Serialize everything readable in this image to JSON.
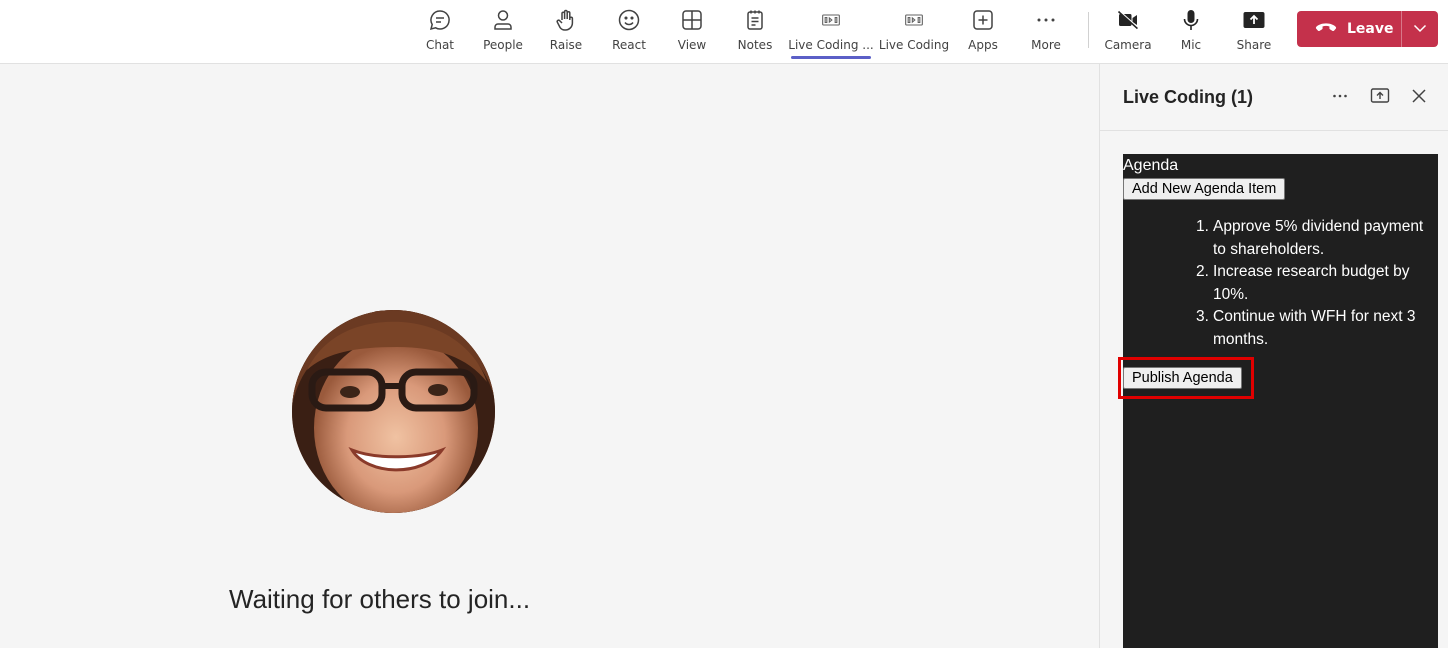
{
  "toolbar": {
    "items": [
      {
        "label": "Chat",
        "icon": "chat-icon"
      },
      {
        "label": "People",
        "icon": "person-icon"
      },
      {
        "label": "Raise",
        "icon": "raise-hand-icon"
      },
      {
        "label": "React",
        "icon": "smile-icon"
      },
      {
        "label": "View",
        "icon": "grid-icon"
      },
      {
        "label": "Notes",
        "icon": "notes-icon"
      },
      {
        "label": "Live Coding ...",
        "icon": "live-coding-icon",
        "active": true
      },
      {
        "label": "Live Coding",
        "icon": "live-coding-icon"
      },
      {
        "label": "Apps",
        "icon": "plus-icon"
      },
      {
        "label": "More",
        "icon": "more-icon"
      },
      {
        "label": "Camera",
        "icon": "camera-off-icon"
      },
      {
        "label": "Mic",
        "icon": "mic-icon"
      },
      {
        "label": "Share",
        "icon": "share-icon"
      }
    ],
    "leave_label": "Leave",
    "leave_color": "#c4314b",
    "accent_color": "#5b5fc7"
  },
  "stage": {
    "waiting_text": "Waiting for others to join..."
  },
  "panel": {
    "title": "Live Coding (1)",
    "app": {
      "heading": "Agenda",
      "add_button": "Add New Agenda Item",
      "items": [
        "Approve 5% dividend payment to shareholders.",
        "Increase research budget by 10%.",
        "Continue with WFH for next 3 months."
      ],
      "publish_button": "Publish Agenda"
    }
  }
}
